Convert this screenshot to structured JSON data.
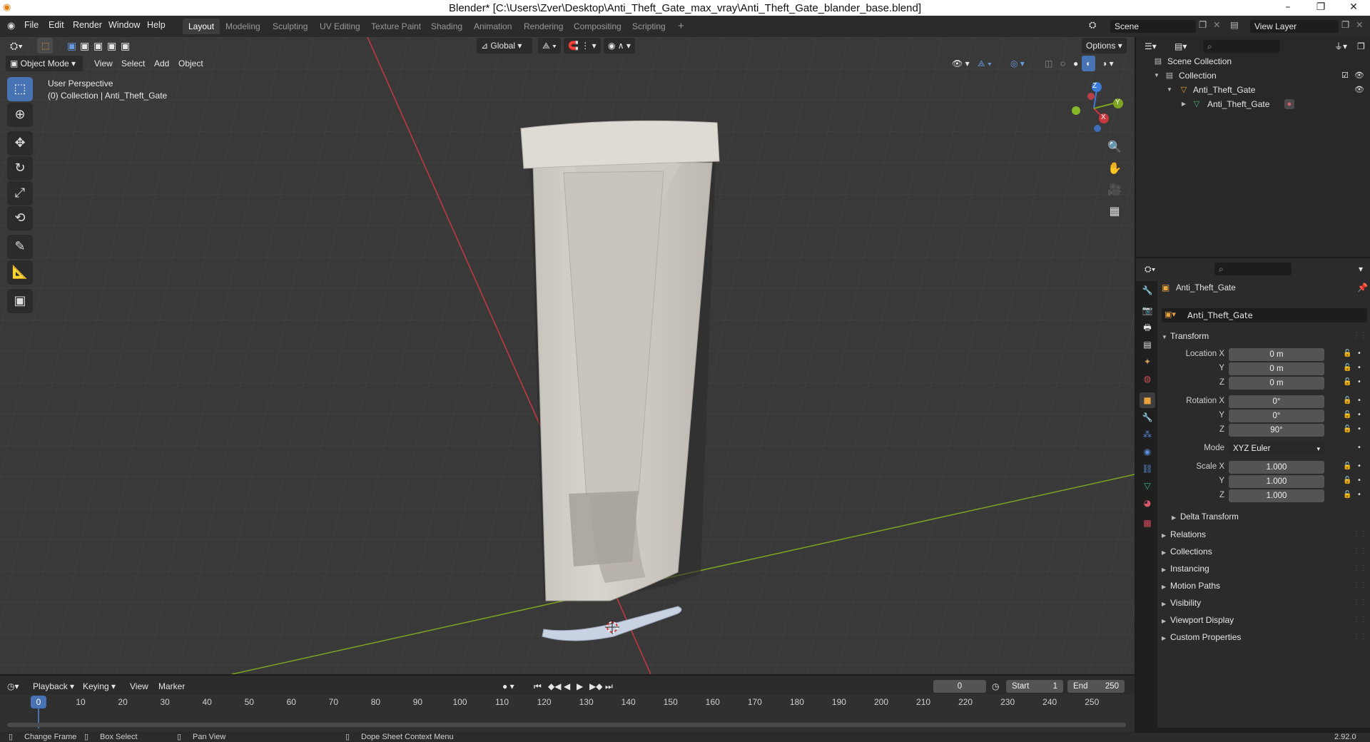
{
  "window": {
    "title": "Blender* [C:\\Users\\Zver\\Desktop\\Anti_Theft_Gate_max_vray\\Anti_Theft_Gate_blander_base.blend]"
  },
  "menu": [
    "File",
    "Edit",
    "Render",
    "Window",
    "Help"
  ],
  "workspaces": [
    {
      "label": "Layout",
      "active": true
    },
    {
      "label": "Modeling"
    },
    {
      "label": "Sculpting"
    },
    {
      "label": "UV Editing"
    },
    {
      "label": "Texture Paint"
    },
    {
      "label": "Shading"
    },
    {
      "label": "Animation"
    },
    {
      "label": "Rendering"
    },
    {
      "label": "Compositing"
    },
    {
      "label": "Scripting"
    }
  ],
  "scene": {
    "label": "Scene"
  },
  "view_layer": {
    "label": "View Layer"
  },
  "viewport_header": {
    "mode": "Object Mode",
    "menus": [
      "View",
      "Select",
      "Add",
      "Object"
    ],
    "orientation": "Global",
    "options": "Options"
  },
  "viewport": {
    "perspective": "User Perspective",
    "collection_info": "(0) Collection | Anti_Theft_Gate",
    "gizmo_axes": [
      "X",
      "Y",
      "Z"
    ]
  },
  "outliner": {
    "rows": [
      {
        "label": "Scene Collection"
      },
      {
        "label": "Collection"
      },
      {
        "label": "Anti_Theft_Gate"
      },
      {
        "label": "Anti_Theft_Gate"
      }
    ]
  },
  "properties": {
    "object_name": "Anti_Theft_Gate",
    "object_field": "Anti_Theft_Gate",
    "transform_title": "Transform",
    "location_label": "Location X",
    "rotation_label": "Rotation X",
    "scale_label": "Scale X",
    "axis_y": "Y",
    "axis_z": "Z",
    "location": [
      "0 m",
      "0 m",
      "0 m"
    ],
    "rotation": [
      "0°",
      "0°",
      "90°"
    ],
    "mode_label": "Mode",
    "mode_value": "XYZ Euler",
    "scale": [
      "1.000",
      "1.000",
      "1.000"
    ],
    "delta_transform": "Delta Transform",
    "panels": [
      "Relations",
      "Collections",
      "Instancing",
      "Motion Paths",
      "Visibility",
      "Viewport Display",
      "Custom Properties"
    ]
  },
  "timeline": {
    "menus": [
      "Playback",
      "Keying",
      "View",
      "Marker"
    ],
    "current_frame": "0",
    "start_label": "Start",
    "start_value": "1",
    "end_label": "End",
    "end_value": "250",
    "ruler": [
      "0",
      "10",
      "20",
      "30",
      "40",
      "50",
      "60",
      "70",
      "80",
      "90",
      "100",
      "110",
      "120",
      "130",
      "140",
      "150",
      "160",
      "170",
      "180",
      "190",
      "200",
      "210",
      "220",
      "230",
      "240",
      "250"
    ]
  },
  "statusbar": {
    "items": [
      "Change Frame",
      "Box Select",
      "Pan View",
      "Dope Sheet Context Menu"
    ],
    "version": "2.92.0"
  },
  "colors": {
    "accent": "#4772b3",
    "x_axis": "#c8383f",
    "y_axis": "#7ea321",
    "z_axis": "#3d7bd8",
    "viewport_bg": "#393939"
  }
}
